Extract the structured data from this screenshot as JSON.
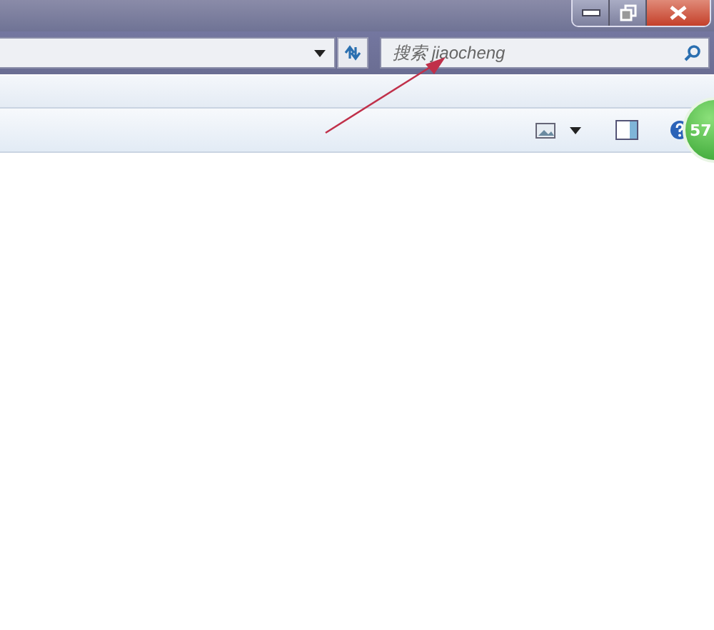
{
  "search": {
    "placeholder": "搜索 jiaocheng"
  },
  "badge": {
    "text": "57"
  }
}
